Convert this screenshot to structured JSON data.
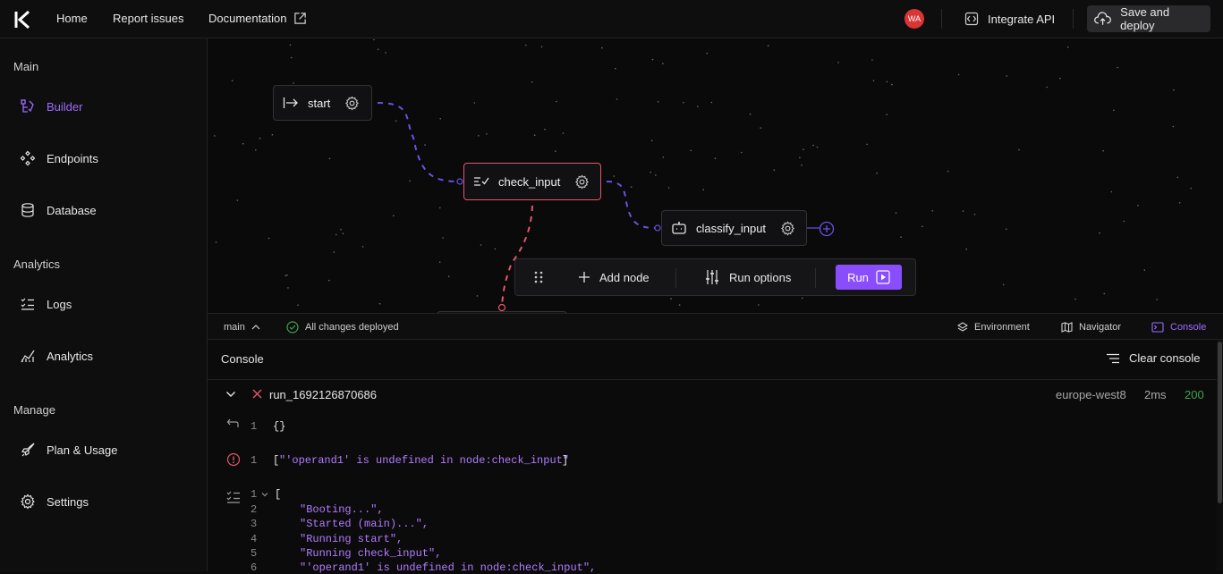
{
  "topbar": {
    "nav": [
      "Home",
      "Report issues",
      "Documentation"
    ],
    "avatar_initials": "WA",
    "integrate_label": "Integrate API",
    "deploy_label": "Save and deploy"
  },
  "sidebar": {
    "sections": [
      {
        "title": "Main",
        "items": [
          "Builder",
          "Endpoints",
          "Database"
        ]
      },
      {
        "title": "Analytics",
        "items": [
          "Logs",
          "Analytics"
        ]
      },
      {
        "title": "Manage",
        "items": [
          "Plan & Usage",
          "Settings"
        ]
      }
    ],
    "active_item": "Builder"
  },
  "canvas": {
    "nodes": [
      "start",
      "check_input",
      "classify_input"
    ],
    "error_node": "check_input",
    "toolbar": {
      "add_node": "Add node",
      "run_options": "Run options",
      "run": "Run"
    }
  },
  "statusbar": {
    "branch": "main",
    "deploy_status": "All changes deployed",
    "environment": "Environment",
    "navigator": "Navigator",
    "console": "Console"
  },
  "console": {
    "title": "Console",
    "clear_label": "Clear console",
    "run": {
      "id": "run_1692126870686",
      "region": "europe-west8",
      "duration": "2ms",
      "status": "200"
    },
    "output_line_no": "1",
    "output": "{}",
    "error_line_no": "1",
    "error_open": "[",
    "error_text": "\"'operand1' is undefined in node:check_input\"",
    "error_close": "]",
    "log_lines": [
      {
        "no": "1",
        "text": "["
      },
      {
        "no": "2",
        "text": "\"Booting...\","
      },
      {
        "no": "3",
        "text": "\"Started (main)...\","
      },
      {
        "no": "4",
        "text": "\"Running start\","
      },
      {
        "no": "5",
        "text": "\"Running check_input\","
      },
      {
        "no": "6",
        "text": "\"'operand1' is undefined in node:check_input\","
      }
    ]
  },
  "colors": {
    "accent": "#8a4dfc",
    "error": "#e2566b",
    "success": "#3fa34d"
  }
}
